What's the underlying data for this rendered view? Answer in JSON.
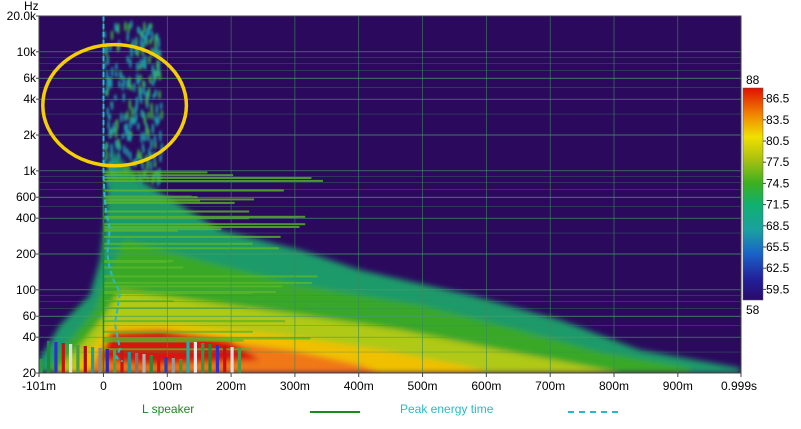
{
  "chart_data": {
    "type": "heatmap",
    "y_unit": "Hz",
    "x_ticks": [
      {
        "value": -0.101,
        "label": "-101m"
      },
      {
        "value": 0,
        "label": "0"
      },
      {
        "value": 0.1,
        "label": "100m"
      },
      {
        "value": 0.2,
        "label": "200m"
      },
      {
        "value": 0.3,
        "label": "300m"
      },
      {
        "value": 0.4,
        "label": "400m"
      },
      {
        "value": 0.5,
        "label": "500m"
      },
      {
        "value": 0.6,
        "label": "600m"
      },
      {
        "value": 0.7,
        "label": "700m"
      },
      {
        "value": 0.8,
        "label": "800m"
      },
      {
        "value": 0.9,
        "label": "900m"
      },
      {
        "value": 0.999,
        "label": "0.999s"
      }
    ],
    "y_ticks": [
      {
        "value": 20,
        "label": "20"
      },
      {
        "value": 40,
        "label": "40"
      },
      {
        "value": 60,
        "label": "60"
      },
      {
        "value": 100,
        "label": "100"
      },
      {
        "value": 200,
        "label": "200"
      },
      {
        "value": 400,
        "label": "400"
      },
      {
        "value": 600,
        "label": "600"
      },
      {
        "value": 1000,
        "label": "1k"
      },
      {
        "value": 2000,
        "label": "2k"
      },
      {
        "value": 4000,
        "label": "4k"
      },
      {
        "value": 6000,
        "label": "6k"
      },
      {
        "value": 10000,
        "label": "10k"
      },
      {
        "value": 20000,
        "label": "20.0k"
      }
    ],
    "xlim": [
      -0.101,
      0.999
    ],
    "ylim": [
      20,
      20000
    ],
    "y_scale": "log",
    "colorbar": {
      "min_label": "58",
      "max_label": "88",
      "range": [
        58,
        88
      ],
      "tick_values": [
        59.5,
        62.5,
        65.5,
        68.5,
        71.5,
        74.5,
        77.5,
        80.5,
        83.5,
        86.5
      ],
      "tick_labels": [
        "59.5",
        "62.5",
        "65.5",
        "68.5",
        "71.5",
        "74.5",
        "77.5",
        "80.5",
        "83.5",
        "86.5"
      ]
    },
    "series": [
      {
        "name": "L speaker",
        "color": "#1a8a1a",
        "style": "solid"
      },
      {
        "name": "Peak energy time",
        "color": "#2ab8c8",
        "style": "dashed",
        "points": [
          {
            "t": 0.0,
            "f": 20000
          },
          {
            "t": 0.0,
            "f": 1500
          },
          {
            "t": 0.0,
            "f": 900
          },
          {
            "t": 0.002,
            "f": 600
          },
          {
            "t": 0.004,
            "f": 450
          },
          {
            "t": 0.01,
            "f": 330
          },
          {
            "t": 0.008,
            "f": 260
          },
          {
            "t": 0.006,
            "f": 200
          },
          {
            "t": 0.01,
            "f": 150
          },
          {
            "t": 0.016,
            "f": 120
          },
          {
            "t": 0.026,
            "f": 95
          },
          {
            "t": 0.022,
            "f": 70
          },
          {
            "t": 0.018,
            "f": 52
          },
          {
            "t": 0.022,
            "f": 40
          },
          {
            "t": 0.026,
            "f": 32
          },
          {
            "t": 0.02,
            "f": 27
          },
          {
            "t": 0.03,
            "f": 25
          }
        ]
      }
    ],
    "annotation": {
      "type": "ellipse",
      "color": "#f5d000",
      "t_range": [
        -0.095,
        0.13
      ],
      "f_range": [
        1100,
        11500
      ]
    },
    "legend_position": "bottom"
  }
}
